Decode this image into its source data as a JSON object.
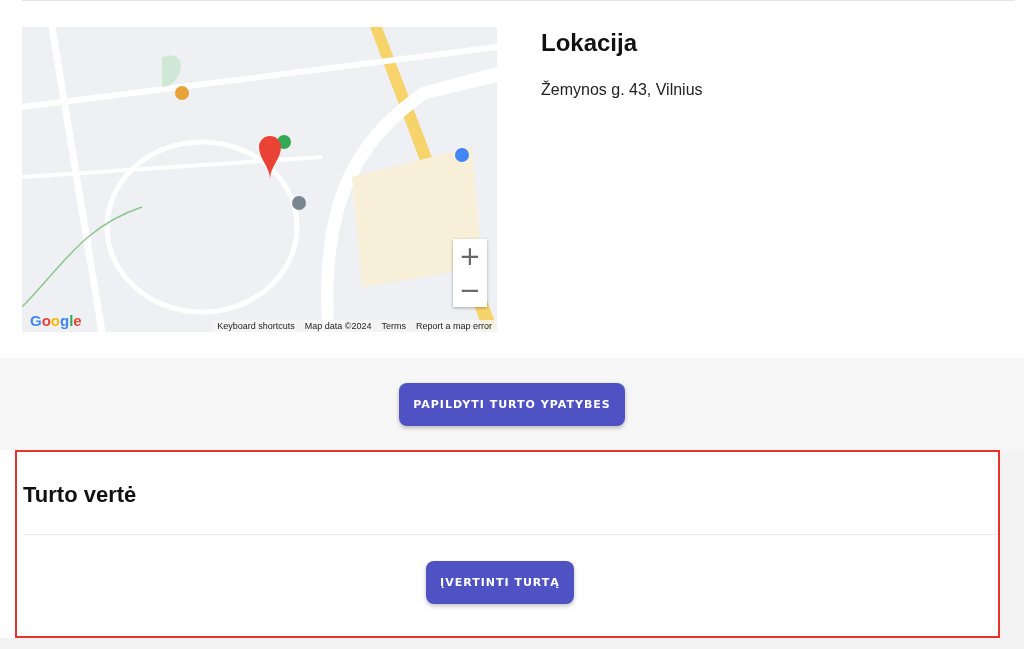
{
  "location": {
    "map": {
      "kind": "picture",
      "zoom_in": "+",
      "zoom_out": "−",
      "logo": "Google",
      "attribution": [
        "Keyboard shortcuts",
        "Map data ©2024",
        "Terms",
        "Report a map error"
      ]
    },
    "title": "Lokacija",
    "address": "Žemynos g. 43, Vilnius"
  },
  "action_band": {
    "button": "PAPILDYTI TURTO YPATYBES"
  },
  "value_section": {
    "highlighted": true,
    "title": "Turto vertė",
    "button": "ĮVERTINTI TURTĄ"
  }
}
